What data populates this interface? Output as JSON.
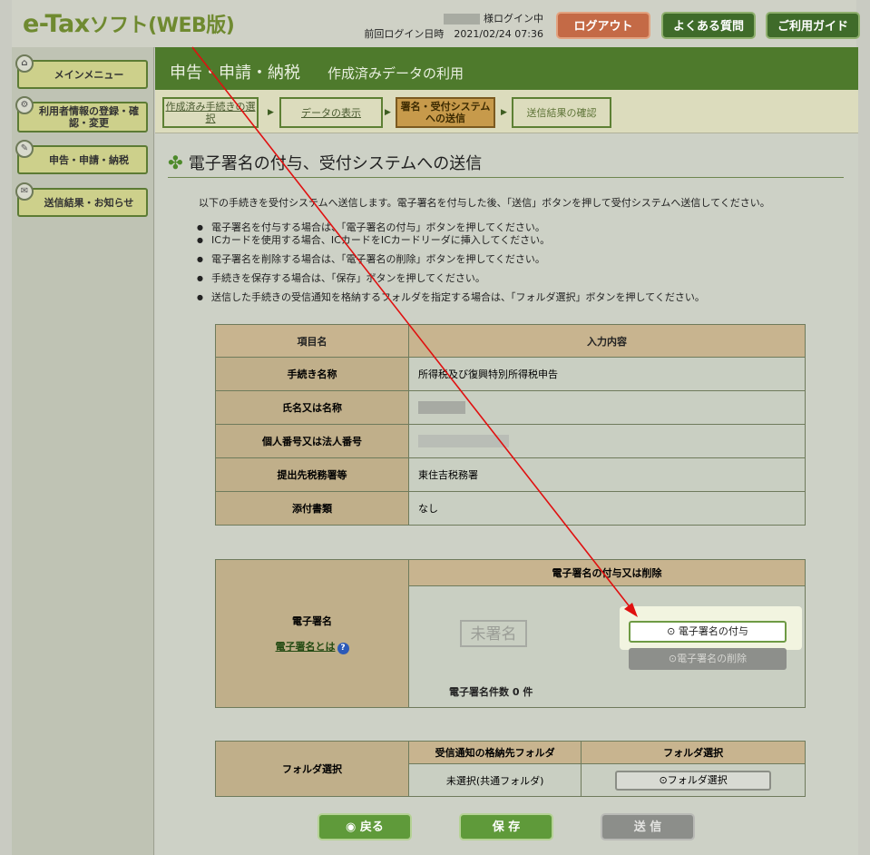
{
  "header": {
    "logo_main": "e-Tax",
    "logo_sub": "ソフト(WEB版)",
    "login_user_suffix": "様ログイン中",
    "last_login_label": "前回ログイン日時",
    "last_login_value": "2021/02/24 07:36",
    "logout": "ログアウト",
    "faq": "よくある質問",
    "guide": "ご利用ガイド"
  },
  "sidebar": {
    "items": [
      {
        "label": "メインメニュー",
        "icon": "home-icon"
      },
      {
        "label": "利用者情報の登録・確認・変更",
        "icon": "settings-icon"
      },
      {
        "label": "申告・申請・納税",
        "icon": "document-icon"
      },
      {
        "label": "送信結果・お知らせ",
        "icon": "mail-icon"
      }
    ]
  },
  "main": {
    "title": "申告・申請・納税",
    "subtitle": "作成済みデータの利用",
    "steps": [
      "作成済み手続きの選択",
      "データの表示",
      "署名・受付システムへの送信",
      "送信結果の確認"
    ],
    "section_title": "電子署名の付与、受付システムへの送信",
    "intro": "以下の手続きを受付システムへ送信します。電子署名を付与した後、「送信」ボタンを押して受付システムへ送信してください。",
    "bullets": [
      "電子署名を付与する場合は、「電子署名の付与」ボタンを押してください。",
      "ICカードを使用する場合、ICカードをICカードリーダに挿入してください。",
      "電子署名を削除する場合は、「電子署名の削除」ボタンを押してください。",
      "手続きを保存する場合は、「保存」ボタンを押してください。",
      "送信した手続きの受信通知を格納するフォルダを指定する場合は、「フォルダ選択」ボタンを押してください。"
    ]
  },
  "info_table": {
    "col_item": "項目名",
    "col_input": "入力内容",
    "rows": [
      {
        "label": "手続き名称",
        "value": "所得税及び復興特別所得税申告"
      },
      {
        "label": "氏名又は名称",
        "value": ""
      },
      {
        "label": "個人番号又は法人番号",
        "value": ""
      },
      {
        "label": "提出先税務署等",
        "value": "東住吉税務署"
      },
      {
        "label": "添付書類",
        "value": "なし"
      }
    ]
  },
  "signature": {
    "label": "電子署名",
    "link": "電子署名とは",
    "header": "電子署名の付与又は削除",
    "status": "未署名",
    "add_button": "電子署名の付与",
    "delete_button": "電子署名の削除",
    "count_text": "電子署名件数 0 件"
  },
  "folder": {
    "label": "フォルダ選択",
    "col_folder": "受信通知の格納先フォルダ",
    "col_select": "フォルダ選択",
    "value": "未選択(共通フォルダ)",
    "button": "フォルダ選択"
  },
  "bottom": {
    "back": "戻る",
    "save": "保 存",
    "send": "送 信"
  },
  "colors": {
    "primary_green": "#4e7a2c",
    "annotation_arrow": "#e01010"
  }
}
